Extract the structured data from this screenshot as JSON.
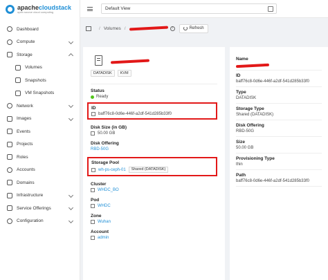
{
  "brand": {
    "name_a": "apache",
    "name_b": "cloudstack",
    "tagline": "open source cloud computing"
  },
  "topbar": {
    "view": "Default View"
  },
  "sidebar": {
    "items": [
      {
        "label": "Dashboard",
        "icon": "dashboard-icon"
      },
      {
        "label": "Compute",
        "icon": "cloud-icon",
        "chevron": "down"
      },
      {
        "label": "Storage",
        "icon": "database-icon",
        "chevron": "up"
      },
      {
        "label": "Volumes",
        "icon": "hdd-icon",
        "sub": true
      },
      {
        "label": "Snapshots",
        "icon": "build-icon",
        "sub": true
      },
      {
        "label": "VM Snapshots",
        "icon": "camera-icon",
        "sub": true
      },
      {
        "label": "Network",
        "icon": "wifi-icon",
        "chevron": "down"
      },
      {
        "label": "Images",
        "icon": "picture-icon",
        "chevron": "down"
      },
      {
        "label": "Events",
        "icon": "schedule-icon"
      },
      {
        "label": "Projects",
        "icon": "project-icon"
      },
      {
        "label": "Roles",
        "icon": "idcard-icon"
      },
      {
        "label": "Accounts",
        "icon": "team-icon"
      },
      {
        "label": "Domains",
        "icon": "block-icon"
      },
      {
        "label": "Infrastructure",
        "icon": "bank-icon",
        "chevron": "down"
      },
      {
        "label": "Service Offerings",
        "icon": "shopping-icon",
        "chevron": "down"
      },
      {
        "label": "Configuration",
        "icon": "setting-icon",
        "chevron": "down"
      }
    ]
  },
  "breadcrumb": {
    "section": "Volumes",
    "refresh": "Refresh"
  },
  "detail": {
    "tags": [
      "DATADISK",
      "KVM"
    ],
    "status_label": "Status",
    "status": "Ready",
    "id_label": "ID",
    "id": "baff76c8-0d6e-446f-a2df-541d285b33f0",
    "size_label": "Disk Size (in GB)",
    "size": "50.00 GB",
    "offering_label": "Disk Offering",
    "offering": "RBD-50G",
    "pool_label": "Storage Pool",
    "pool": "wh-ps-ceph-01",
    "pool_tag": "Shared (DATADISK)",
    "cluster_label": "Cluster",
    "cluster": "WHDC_BO",
    "pod_label": "Pod",
    "pod": "WHDC",
    "zone_label": "Zone",
    "zone": "Wuhan",
    "account_label": "Account",
    "account": "admin"
  },
  "summary": [
    {
      "label": "Name",
      "value": ""
    },
    {
      "label": "ID",
      "value": "baff76c8-0d6e-446f-a2df-541d285b33f0"
    },
    {
      "label": "Type",
      "value": "DATADISK"
    },
    {
      "label": "Storage Type",
      "value": "Shared (DATADISK)"
    },
    {
      "label": "Disk Offering",
      "value": "RBD-50G"
    },
    {
      "label": "Size",
      "value": "50.00 GB"
    },
    {
      "label": "Provisioning Type",
      "value": "thin"
    },
    {
      "label": "Path",
      "value": "baff76c8-0d6e-446f-a2df-541d285b33f0"
    }
  ],
  "colors": {
    "accent": "#1f8fd6",
    "highlight": "#e21818",
    "ready": "#52c41a"
  }
}
